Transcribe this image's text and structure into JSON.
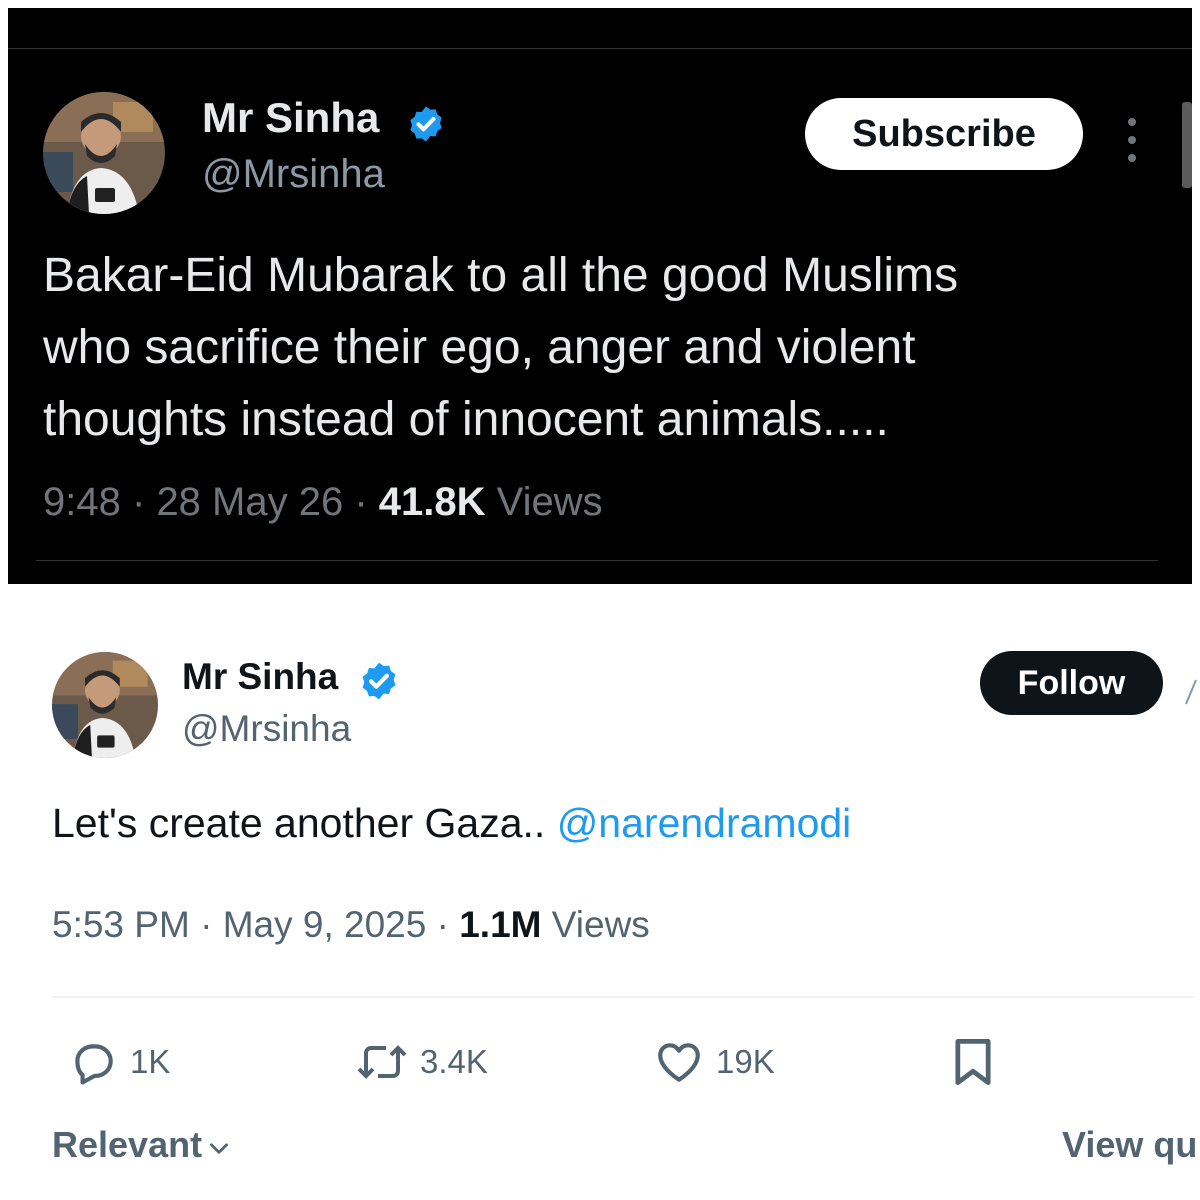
{
  "top_tweet": {
    "author_name": "Mr Sinha",
    "handle": "@Mrsinha",
    "subscribe_label": "Subscribe",
    "text_lines": [
      "Bakar-Eid Mubarak to all the good Muslims",
      "who sacrifice their ego, anger and violent",
      "thoughts instead of innocent animals....."
    ],
    "time": "9:48",
    "date": "28 May 26",
    "views_count": "41.8K",
    "views_label": "Views",
    "separator": "·"
  },
  "bottom_tweet": {
    "author_name": "Mr Sinha",
    "handle": "@Mrsinha",
    "follow_label": "Follow",
    "text": "Let's create another Gaza..",
    "mention": "@narendramodi",
    "time": "5:53 PM",
    "date": "May 9, 2025",
    "views_count": "1.1M",
    "views_label": "Views",
    "separator": "·",
    "actions": {
      "replies": "1K",
      "reposts": "3.4K",
      "likes": "19K"
    },
    "sort_label": "Relevant",
    "view_quotes_label": "View qu"
  },
  "icons": [
    "verified-badge-icon",
    "more-options-icon",
    "reply-icon",
    "repost-icon",
    "like-icon",
    "bookmark-icon",
    "chevron-down-icon"
  ],
  "colors": {
    "dark_bg": "#000000",
    "verified_blue": "#1d9bf0",
    "mention_blue": "#1d9bf0",
    "follow_bg": "#0f1419",
    "subscribe_bg": "#ffffff"
  }
}
